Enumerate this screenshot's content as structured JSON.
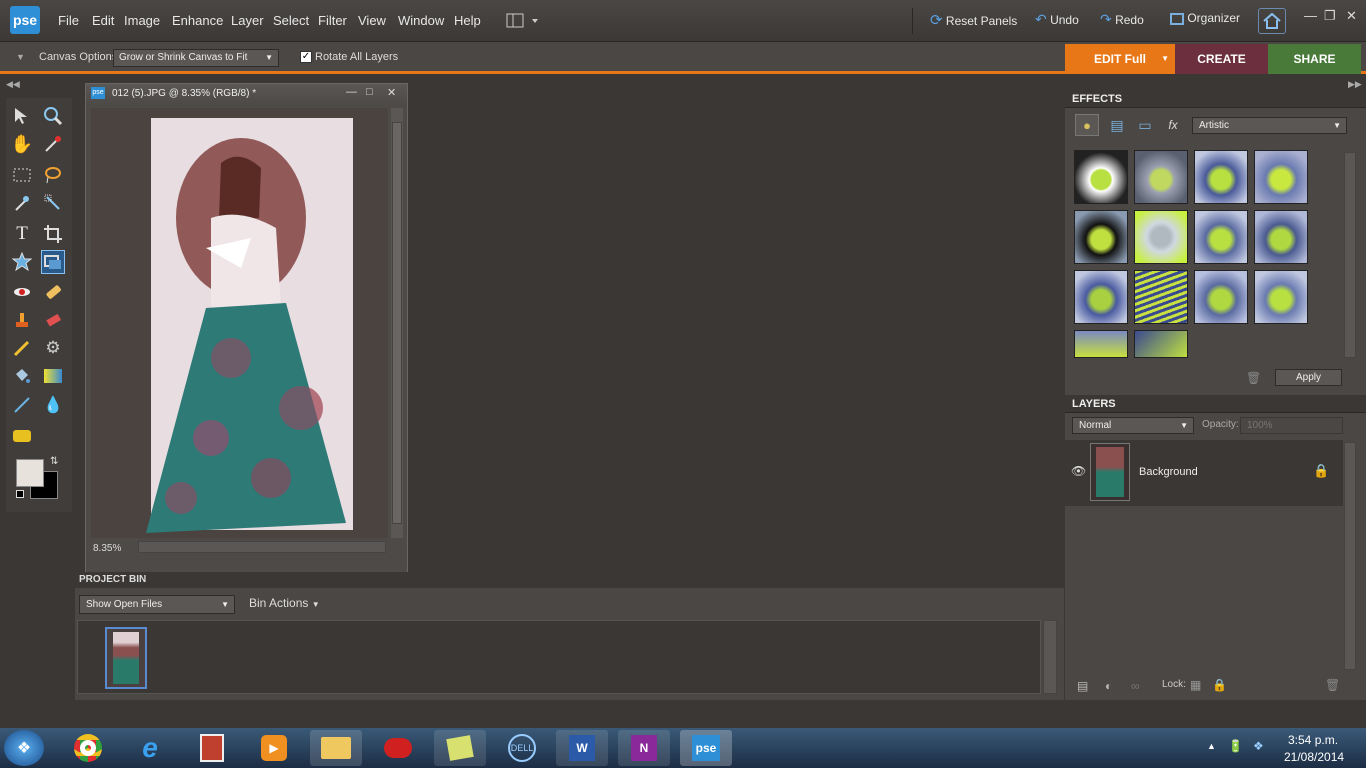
{
  "app": {
    "logo": "pse"
  },
  "menu": [
    "File",
    "Edit",
    "Image",
    "Enhance",
    "Layer",
    "Select",
    "Filter",
    "View",
    "Window",
    "Help"
  ],
  "topbar": {
    "reset_panels": "Reset Panels",
    "undo": "Undo",
    "redo": "Redo",
    "organizer": "Organizer"
  },
  "options": {
    "canvas_label": "Canvas Options:",
    "canvas_value": "Grow or Shrink Canvas to Fit",
    "rotate_all": "Rotate All Layers",
    "rotate_checked": true
  },
  "tabs": {
    "edit": "EDIT Full",
    "create": "CREATE",
    "share": "SHARE",
    "edit_color": "#e87717",
    "create_color": "#6b2f3d",
    "share_color": "#4a7a3a"
  },
  "document": {
    "title": "012 (5).JPG @ 8.35% (RGB/8) *",
    "zoom": "8.35%"
  },
  "effects": {
    "header": "EFFECTS",
    "category": "Artistic",
    "apply": "Apply"
  },
  "layers": {
    "header": "LAYERS",
    "blend_mode": "Normal",
    "opacity_label": "Opacity:",
    "opacity_value": "100%",
    "layer_name": "Background",
    "lock_label": "Lock:"
  },
  "bin": {
    "header": "PROJECT BIN",
    "show": "Show Open Files",
    "actions": "Bin Actions"
  },
  "clock": {
    "time": "3:54 p.m.",
    "date": "21/08/2014"
  }
}
